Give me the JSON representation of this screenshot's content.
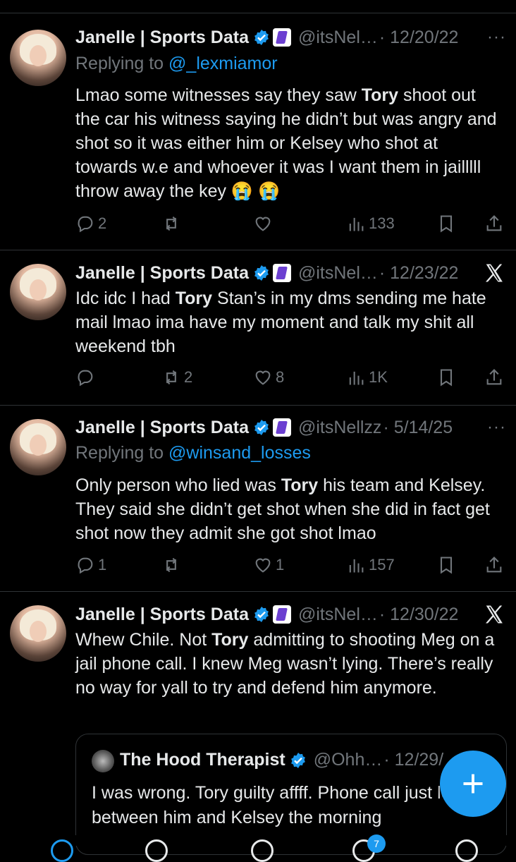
{
  "colors": {
    "background": "#000000",
    "text": "#e7e9ea",
    "muted": "#71767b",
    "accent": "#1d9bf0"
  },
  "tweets": [
    {
      "name": "Janelle | Sports Data",
      "handle": "@itsNel…",
      "date": "· 12/20/22",
      "replying_prefix": "Replying to ",
      "replying_to": "@_lexmiamor",
      "text_parts": [
        "Lmao some witnesses say they saw ",
        "Tory",
        " shoot out the car his witness saying he didn’t but was angry and shot so it was either him or Kelsey who shot at towards w.e and whoever it was I want them in jailllll throw away the key 😭 😭"
      ],
      "replies": "2",
      "reposts": "",
      "likes": "",
      "views": "133",
      "corner_icon": "more-icon"
    },
    {
      "name": "Janelle | Sports Data",
      "handle": "@itsNel…",
      "date": "· 12/23/22",
      "text_parts": [
        "Idc idc I had ",
        "Tory",
        " Stan’s in my dms sending me hate mail lmao ima have my moment and talk my shit all weekend tbh"
      ],
      "replies": "",
      "reposts": "2",
      "likes": "8",
      "views": "1K",
      "corner_icon": "x-logo-icon"
    },
    {
      "name": "Janelle | Sports Data",
      "handle": "@itsNellzz",
      "date": "· 5/14/25",
      "replying_prefix": "Replying to ",
      "replying_to": "@winsand_losses",
      "text_parts": [
        "Only person who lied was ",
        "Tory",
        " his team and Kelsey. They said she didn’t get shot when she did in fact get shot now they admit she got shot lmao"
      ],
      "replies": "1",
      "reposts": "",
      "likes": "1",
      "views": "157",
      "corner_icon": "more-icon"
    },
    {
      "name": "Janelle | Sports Data",
      "handle": "@itsNel…",
      "date": "· 12/30/22",
      "text_parts": [
        "Whew Chile. Not ",
        "Tory",
        " admitting to shooting Meg on a jail phone call. I knew Meg wasn’t lying. There’s really no way for yall to try and defend him anymore."
      ],
      "corner_icon": "x-logo-icon",
      "quote": {
        "name": "The Hood Therapist",
        "handle": "@Ohh…",
        "date": "· 12/29/",
        "text": "I was wrong. Tory guilty affff. Phone call just leaked between him and Kelsey the morning"
      }
    }
  ],
  "more_symbol": "···",
  "fab_label": "+",
  "nav": {
    "notifications_badge": "7"
  }
}
